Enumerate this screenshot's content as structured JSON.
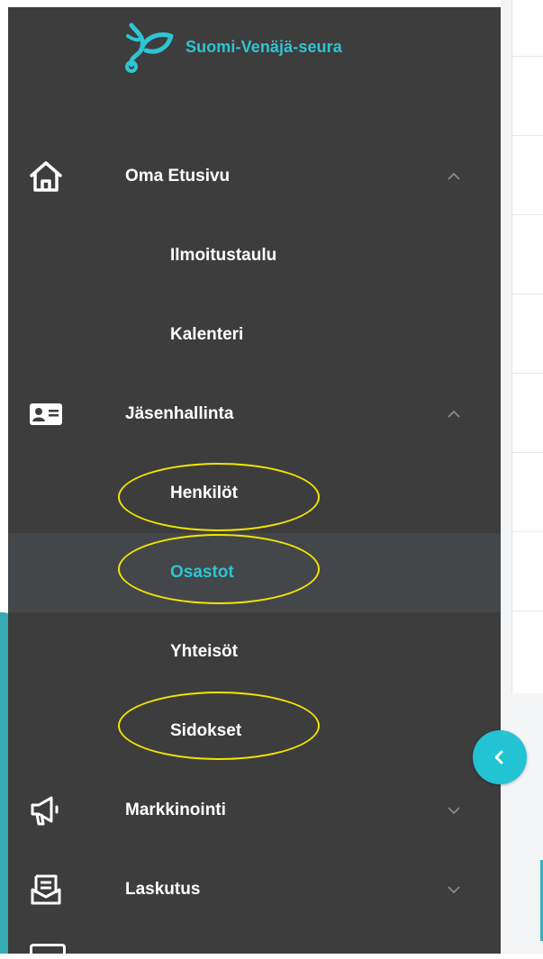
{
  "brand": {
    "name": "Suomi-Venäjä-seura",
    "accent_color": "#2ec4d3",
    "sidebar_color": "#3d3d3d",
    "highlight_color": "#f2e400"
  },
  "nav": {
    "home": {
      "label": "Oma Etusivu",
      "icon": "home-icon",
      "expanded": true
    },
    "home_children": [
      {
        "label": "Ilmoitustaulu"
      },
      {
        "label": "Kalenteri"
      }
    ],
    "members": {
      "label": "Jäsenhallinta",
      "icon": "id-card-icon",
      "expanded": true
    },
    "members_children": [
      {
        "label": "Henkilöt",
        "highlighted": true
      },
      {
        "label": "Osastot",
        "active": true,
        "highlighted": true
      },
      {
        "label": "Yhteisöt"
      },
      {
        "label": "Sidokset",
        "highlighted": true
      }
    ],
    "marketing": {
      "label": "Markkinointi",
      "icon": "megaphone-icon",
      "expanded": false
    },
    "billing": {
      "label": "Laskutus",
      "icon": "invoice-icon",
      "expanded": false
    }
  },
  "collapse_button": {
    "icon": "chevron-left-icon"
  }
}
